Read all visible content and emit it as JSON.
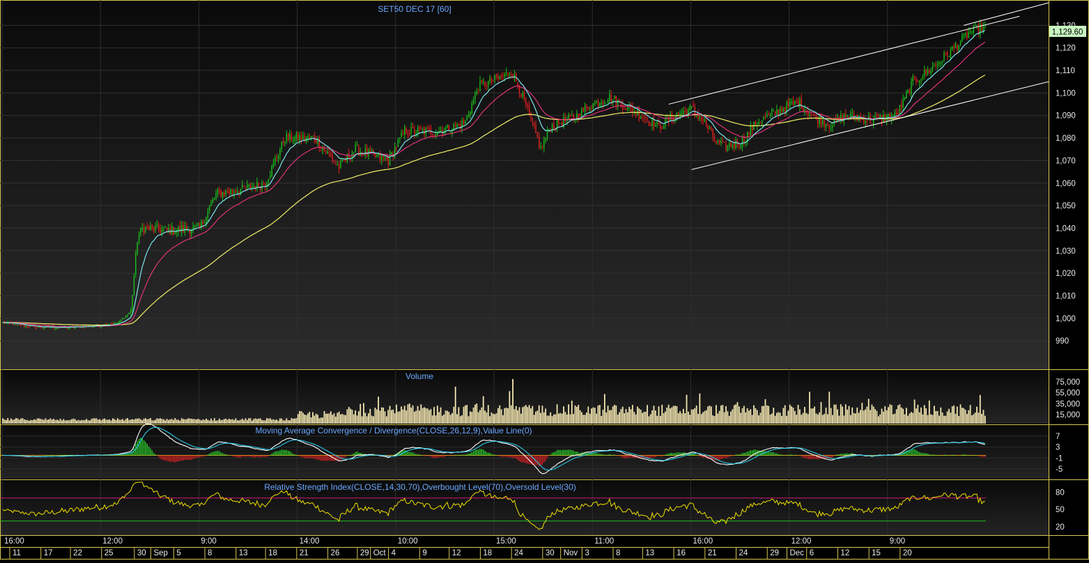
{
  "chart_data": [
    {
      "type": "candlestick",
      "title": "SET50 DEC 17   [60]",
      "last_price_label": "1,129.60",
      "y_ticks": [
        990,
        1000,
        1010,
        1020,
        1030,
        1040,
        1050,
        1060,
        1070,
        1080,
        1090,
        1100,
        1110,
        1120,
        1130
      ],
      "y_tick_labels": [
        "990",
        "1,000",
        "1,010",
        "1,020",
        "1,030",
        "1,040",
        "1,050",
        "1,060",
        "1,070",
        "1,080",
        "1,090",
        "1,100",
        "1,110",
        "1,120",
        "1,130"
      ],
      "ylim": [
        978,
        1140
      ],
      "n_bars": 600,
      "close_anchors": [
        [
          0,
          998
        ],
        [
          20,
          996
        ],
        [
          40,
          996
        ],
        [
          60,
          997
        ],
        [
          70,
          998
        ],
        [
          78,
          1003
        ],
        [
          82,
          1035
        ],
        [
          85,
          1040
        ],
        [
          100,
          1039
        ],
        [
          120,
          1040
        ],
        [
          130,
          1055
        ],
        [
          150,
          1058
        ],
        [
          160,
          1060
        ],
        [
          172,
          1080
        ],
        [
          190,
          1080
        ],
        [
          205,
          1067
        ],
        [
          215,
          1075
        ],
        [
          235,
          1070
        ],
        [
          245,
          1083
        ],
        [
          265,
          1083
        ],
        [
          275,
          1085
        ],
        [
          282,
          1087
        ],
        [
          290,
          1103
        ],
        [
          305,
          1107
        ],
        [
          310,
          1110
        ],
        [
          315,
          1102
        ],
        [
          322,
          1088
        ],
        [
          328,
          1075
        ],
        [
          334,
          1085
        ],
        [
          350,
          1090
        ],
        [
          360,
          1095
        ],
        [
          370,
          1098
        ],
        [
          385,
          1092
        ],
        [
          400,
          1085
        ],
        [
          410,
          1090
        ],
        [
          420,
          1093
        ],
        [
          428,
          1087
        ],
        [
          435,
          1078
        ],
        [
          440,
          1076
        ],
        [
          450,
          1078
        ],
        [
          460,
          1087
        ],
        [
          475,
          1093
        ],
        [
          485,
          1096
        ],
        [
          495,
          1089
        ],
        [
          505,
          1086
        ],
        [
          515,
          1090
        ],
        [
          530,
          1088
        ],
        [
          545,
          1090
        ],
        [
          555,
          1105
        ],
        [
          565,
          1110
        ],
        [
          580,
          1120
        ],
        [
          590,
          1127
        ],
        [
          600,
          1129.6
        ]
      ],
      "ema_fast_period": 12,
      "ema_mid_period": 30,
      "ema_slow_period": 100,
      "ema_fast_color": "#7fe6f0",
      "ema_mid_color": "#e0337a",
      "ema_slow_color": "#f2f06a",
      "up_color": "#19c119",
      "down_color": "#e02020",
      "trend_channel": {
        "line1": [
          [
            406,
            1095
          ],
          [
            620,
            1134
          ]
        ],
        "line2": [
          [
            420,
            1066
          ],
          [
            640,
            1105
          ]
        ],
        "line3": [
          [
            586,
            1130
          ],
          [
            640,
            1140
          ]
        ]
      }
    },
    {
      "type": "bar",
      "title": "Volume",
      "y_tick_labels": [
        "75,000",
        "55,000",
        "35,000",
        "15,000"
      ],
      "y_ticks": [
        75000,
        55000,
        35000,
        15000
      ],
      "ylim": [
        0,
        85000
      ],
      "bar_color": "#f4e7b0"
    },
    {
      "type": "line",
      "title": "Moving Average Convergence / Divergence(CLOSE,26,12,9),Value Line(0)",
      "y_tick_labels": [
        "7",
        "3",
        "-1",
        "-5"
      ],
      "y_ticks": [
        7,
        3,
        -1,
        -5
      ],
      "ylim": [
        -8,
        10
      ],
      "macd_color": "#ffffff",
      "signal_color": "#28c8e8",
      "hist_up_color": "#2ad12a",
      "hist_down_color": "#e02020",
      "zero_line_color": "#c8b020"
    },
    {
      "type": "line",
      "title": "Relative Strength Index(CLOSE,14,30,70),Overbought Level(70),Oversold Level(30)",
      "y_tick_labels": [
        "80",
        "50",
        "20"
      ],
      "y_ticks": [
        80,
        50,
        20
      ],
      "ylim": [
        8,
        95
      ],
      "overbought": 70,
      "oversold": 30,
      "rsi_color": "#f0e000",
      "overbought_color": "#d01870",
      "oversold_color": "#20c020"
    }
  ],
  "x_axis": {
    "time_labels": [
      {
        "bar": 0,
        "text": "16:00"
      },
      {
        "bar": 60,
        "text": "12:00"
      },
      {
        "bar": 120,
        "text": "9:00"
      },
      {
        "bar": 180,
        "text": "14:00"
      },
      {
        "bar": 240,
        "text": "10:00"
      },
      {
        "bar": 300,
        "text": "15:00"
      },
      {
        "bar": 360,
        "text": "11:00"
      },
      {
        "bar": 420,
        "text": "16:00"
      },
      {
        "bar": 480,
        "text": "12:00"
      },
      {
        "bar": 540,
        "text": "9:00"
      }
    ],
    "date_labels": [
      {
        "bar": 8,
        "text": "11"
      },
      {
        "bar": 27,
        "text": "17"
      },
      {
        "bar": 45,
        "text": "22"
      },
      {
        "bar": 64,
        "text": "25"
      },
      {
        "bar": 84,
        "text": "30"
      },
      {
        "bar": 94,
        "text": "Sep"
      },
      {
        "bar": 108,
        "text": "5"
      },
      {
        "bar": 127,
        "text": "8"
      },
      {
        "bar": 146,
        "text": "13"
      },
      {
        "bar": 164,
        "text": "18"
      },
      {
        "bar": 183,
        "text": "21"
      },
      {
        "bar": 202,
        "text": "26"
      },
      {
        "bar": 220,
        "text": "29"
      },
      {
        "bar": 228,
        "text": "Oct"
      },
      {
        "bar": 239,
        "text": "4"
      },
      {
        "bar": 258,
        "text": "9"
      },
      {
        "bar": 276,
        "text": "12"
      },
      {
        "bar": 295,
        "text": "18"
      },
      {
        "bar": 314,
        "text": "24"
      },
      {
        "bar": 333,
        "text": "30"
      },
      {
        "bar": 344,
        "text": "Nov"
      },
      {
        "bar": 357,
        "text": "3"
      },
      {
        "bar": 376,
        "text": "8"
      },
      {
        "bar": 394,
        "text": "13"
      },
      {
        "bar": 413,
        "text": "16"
      },
      {
        "bar": 432,
        "text": "21"
      },
      {
        "bar": 451,
        "text": "24"
      },
      {
        "bar": 470,
        "text": "29"
      },
      {
        "bar": 482,
        "text": "Dec"
      },
      {
        "bar": 494,
        "text": "6"
      },
      {
        "bar": 513,
        "text": "12"
      },
      {
        "bar": 532,
        "text": "15"
      },
      {
        "bar": 551,
        "text": "20"
      }
    ]
  }
}
